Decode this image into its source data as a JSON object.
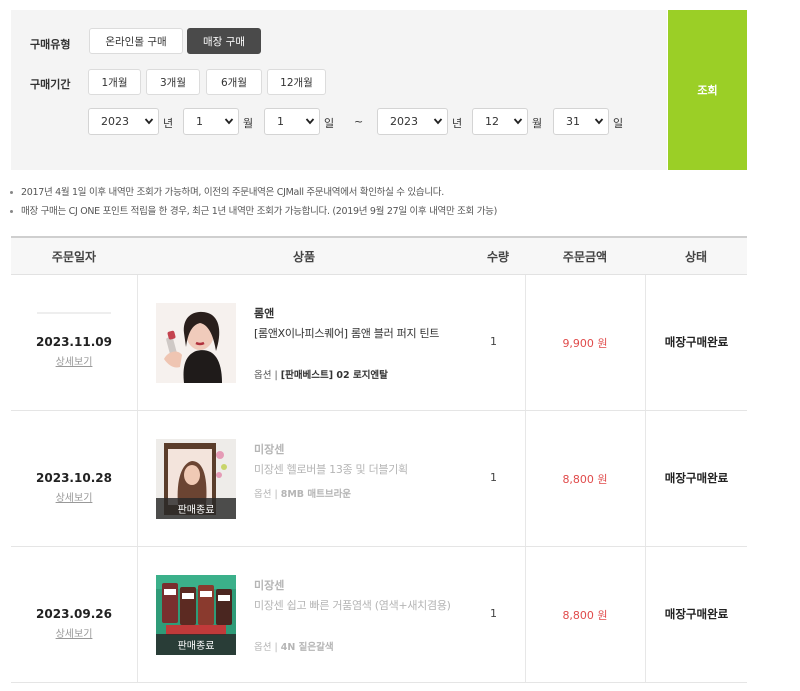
{
  "filter": {
    "purchase_type_label": "구매유형",
    "purchase_types": [
      "온라인몰 구매",
      "매장 구매"
    ],
    "selected_purchase_type": "매장 구매",
    "period_label": "구매기간",
    "periods": [
      "1개월",
      "3개월",
      "6개월",
      "12개월"
    ],
    "from": {
      "year": "2023",
      "month": "1",
      "day": "1"
    },
    "to": {
      "year": "2023",
      "month": "12",
      "day": "31"
    },
    "year_unit": "년",
    "month_unit": "월",
    "day_unit": "일",
    "range_separator": "~",
    "search_label": "조회",
    "accent_color": "#9bcf26"
  },
  "notes": [
    "2017년 4월 1일 이후 내역만 조회가 가능하며, 이전의 주문내역은 CJMall 주문내역에서 확인하실 수 있습니다.",
    "매장 구매는 CJ ONE 포인트 적립을 한 경우, 최근 1년 내역만 조회가 가능합니다. (2019년 9월 27일 이후 내역만 조회 가능)"
  ],
  "table": {
    "headers": [
      "주문일자",
      "상품",
      "수량",
      "주문금액",
      "상태"
    ],
    "detail_label": "상세보기",
    "option_label": "옵션",
    "soldout_label": "판매종료",
    "rows": [
      {
        "date": "2023.11.09",
        "brand": "롬앤",
        "product": "[롬앤X이나피스퀘어] 롬앤 블러 퍼지 틴트",
        "option": "[판매베스트] 02 로지엔탈",
        "qty": "1",
        "amount": "9,900 원",
        "status": "매장구매완료",
        "soldout": false
      },
      {
        "date": "2023.10.28",
        "brand": "미장센",
        "product": "미장센 헬로버블 13종 및 더블기획",
        "option": "8MB 매트브라운",
        "qty": "1",
        "amount": "8,800 원",
        "status": "매장구매완료",
        "soldout": true
      },
      {
        "date": "2023.09.26",
        "brand": "미장센",
        "product": "미장센 쉽고 빠른 거품염색 (염색+새치겸용)",
        "option": "4N 짙은갈색",
        "qty": "1",
        "amount": "8,800 원",
        "status": "매장구매완료",
        "soldout": true
      }
    ]
  }
}
